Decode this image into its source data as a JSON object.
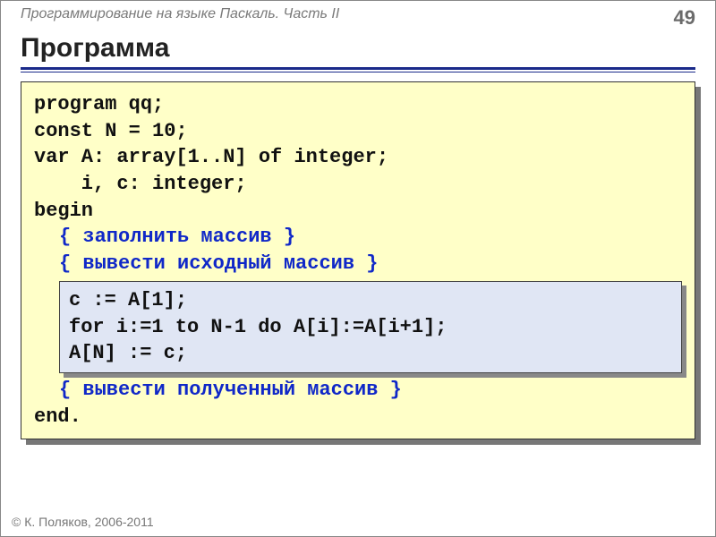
{
  "header": {
    "course": "Программирование на языке Паскаль. Часть II",
    "page": "49"
  },
  "title": "Программа",
  "code": {
    "l1": "program qq;",
    "l2": "const N = 10;",
    "l3": "var A: array[1..N] of integer;",
    "l4": "    i, c: integer;",
    "l5": "begin",
    "c1": "{ заполнить массив }",
    "c2": "{ вывести исходный массив }",
    "h1": "c := A[1];",
    "h2": "for i:=1 to N-1 do A[i]:=A[i+1];",
    "h3": "A[N] := c;",
    "c3": "{ вывести полученный массив }",
    "l6": "end."
  },
  "footer": "© К. Поляков, 2006-2011"
}
